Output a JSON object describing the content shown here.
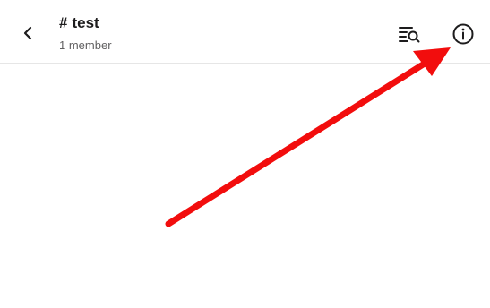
{
  "header": {
    "back_icon": "chevron-left-icon",
    "channel_prefix": "#",
    "channel_name": "test",
    "member_count": "1 member",
    "search_icon": "search-in-conversation-icon",
    "info_icon": "info-circle-icon"
  },
  "annotation": {
    "type": "arrow",
    "color": "#f20d0d",
    "points_to": "info-button"
  }
}
